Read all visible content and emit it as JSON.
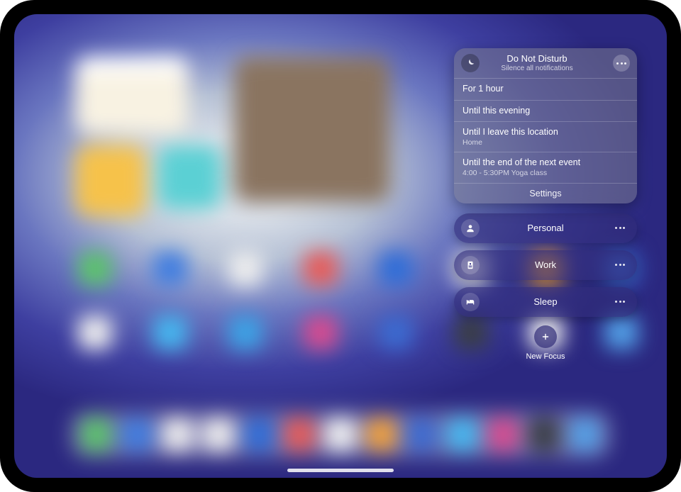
{
  "dnd": {
    "title": "Do Not Disturb",
    "subtitle": "Silence all notifications",
    "options": [
      {
        "label": "For 1 hour"
      },
      {
        "label": "Until this evening"
      },
      {
        "label": "Until I leave this location",
        "detail": "Home"
      },
      {
        "label": "Until the end of the next event",
        "detail": "4:00 - 5:30PM Yoga class"
      }
    ],
    "settings_label": "Settings"
  },
  "modes": [
    {
      "label": "Personal",
      "icon": "person"
    },
    {
      "label": "Work",
      "icon": "badge"
    },
    {
      "label": "Sleep",
      "icon": "bed"
    }
  ],
  "new_focus_label": "New Focus"
}
